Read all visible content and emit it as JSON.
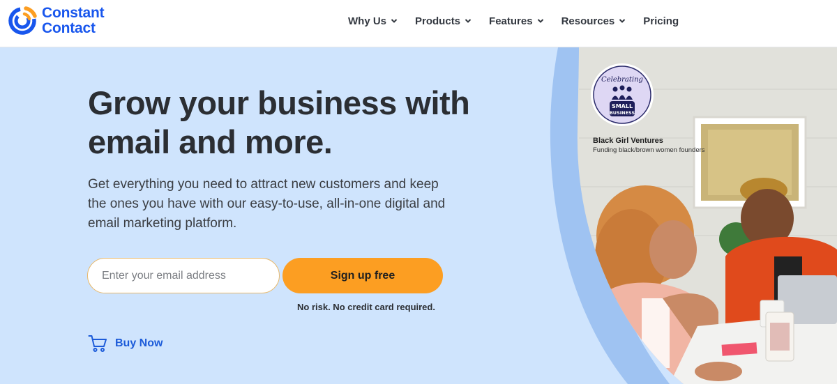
{
  "brand": {
    "line1": "Constant",
    "line2": "Contact",
    "color": "#1856ed"
  },
  "nav": {
    "items": [
      {
        "label": "Why Us",
        "has_dropdown": true
      },
      {
        "label": "Products",
        "has_dropdown": true
      },
      {
        "label": "Features",
        "has_dropdown": true
      },
      {
        "label": "Resources",
        "has_dropdown": true
      },
      {
        "label": "Pricing",
        "has_dropdown": false
      }
    ]
  },
  "hero": {
    "headline_line1": "Grow your business with",
    "headline_line2": "email and more.",
    "subtext": "Get everything you need to attract new customers and keep the ones you have with our easy-to-use, all-in-one digital and email marketing platform.",
    "email_placeholder": "Enter your email address",
    "signup_label": "Sign up free",
    "no_risk_text": "No risk. No credit card required.",
    "buy_now_label": "Buy Now",
    "background_color": "#cfe4fd",
    "accent_color": "#fc9e22"
  },
  "badge": {
    "line1": "Celebrating",
    "line2": "SMALL",
    "line3": "BUSINESS"
  },
  "photo_caption": {
    "title": "Black Girl Ventures",
    "subtitle": "Funding black/brown women founders"
  },
  "icons": {
    "logo": "constant-contact-logo-icon",
    "dropdown": "chevron-down-icon",
    "cart": "shopping-cart-icon"
  }
}
